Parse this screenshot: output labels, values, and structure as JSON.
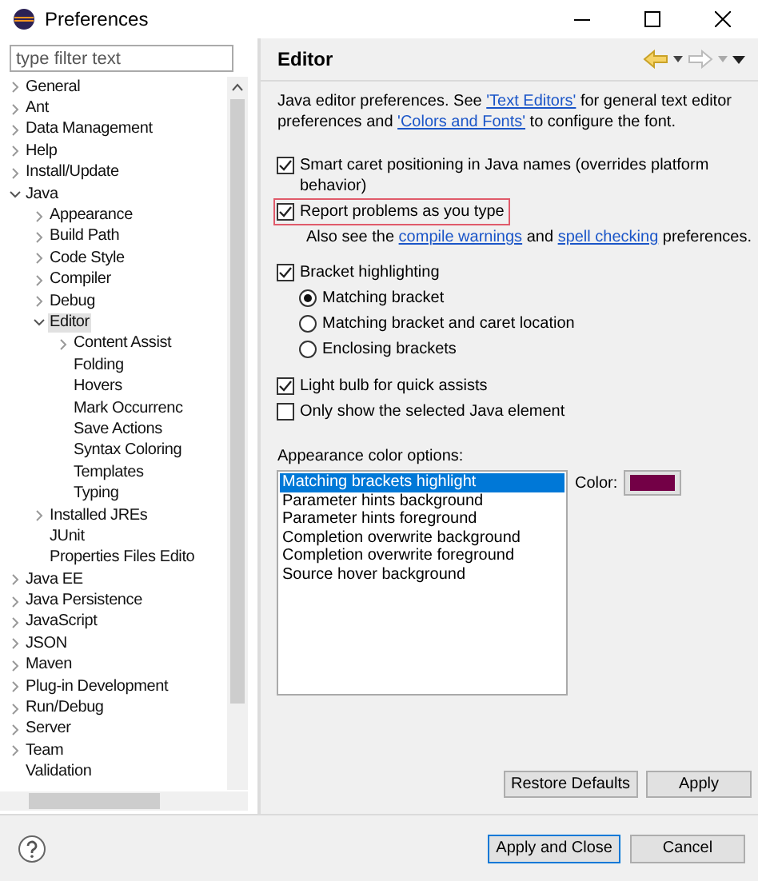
{
  "window": {
    "title": "Preferences"
  },
  "filter": {
    "placeholder": "type filter text"
  },
  "tree": [
    {
      "label": "General",
      "expanded": false,
      "selected": false
    },
    {
      "label": "Ant",
      "expanded": false,
      "selected": false
    },
    {
      "label": "Data Management",
      "expanded": false,
      "selected": false
    },
    {
      "label": "Help",
      "expanded": false,
      "selected": false
    },
    {
      "label": "Install/Update",
      "expanded": false,
      "selected": false
    },
    {
      "label": "Java",
      "expanded": true,
      "selected": false,
      "children": [
        {
          "label": "Appearance",
          "expanded": false,
          "selected": false
        },
        {
          "label": "Build Path",
          "expanded": false,
          "selected": false
        },
        {
          "label": "Code Style",
          "expanded": false,
          "selected": false
        },
        {
          "label": "Compiler",
          "expanded": false,
          "selected": false
        },
        {
          "label": "Debug",
          "expanded": false,
          "selected": false
        },
        {
          "label": "Editor",
          "expanded": true,
          "selected": true,
          "children": [
            {
              "label": "Content Assist",
              "expanded": false,
              "selected": false
            },
            {
              "label": "Folding",
              "selected": false
            },
            {
              "label": "Hovers",
              "selected": false
            },
            {
              "label": "Mark Occurrenc",
              "selected": false
            },
            {
              "label": "Save Actions",
              "selected": false
            },
            {
              "label": "Syntax Coloring",
              "selected": false
            },
            {
              "label": "Templates",
              "selected": false
            },
            {
              "label": "Typing",
              "selected": false
            }
          ]
        },
        {
          "label": "Installed JREs",
          "expanded": false,
          "selected": false
        },
        {
          "label": "JUnit",
          "selected": false
        },
        {
          "label": "Properties Files Edito",
          "selected": false
        }
      ]
    },
    {
      "label": "Java EE",
      "expanded": false,
      "selected": false
    },
    {
      "label": "Java Persistence",
      "expanded": false,
      "selected": false
    },
    {
      "label": "JavaScript",
      "expanded": false,
      "selected": false
    },
    {
      "label": "JSON",
      "expanded": false,
      "selected": false
    },
    {
      "label": "Maven",
      "expanded": false,
      "selected": false
    },
    {
      "label": "Plug-in Development",
      "expanded": false,
      "selected": false
    },
    {
      "label": "Run/Debug",
      "expanded": false,
      "selected": false
    },
    {
      "label": "Server",
      "expanded": false,
      "selected": false
    },
    {
      "label": "Team",
      "expanded": false,
      "selected": false
    },
    {
      "label": "Validation",
      "selected": false
    }
  ],
  "page": {
    "title": "Editor",
    "description": [
      {
        "text": "Java editor preferences. See ",
        "link": false
      },
      {
        "text": "'Text Editors'",
        "link": true
      },
      {
        "text": " for general text editor preferences and ",
        "link": false
      },
      {
        "text": "'Colors and Fonts'",
        "link": true
      },
      {
        "text": " to configure the font.",
        "link": false
      }
    ],
    "option_groups": [
      [
        {
          "kind": "checkbox",
          "label": "Smart caret positioning in Java names (overrides platform behavior)",
          "checked": true,
          "highlighted": false
        },
        {
          "kind": "checkbox",
          "label": "Report problems as you type",
          "checked": true,
          "highlighted": true
        },
        {
          "kind": "note",
          "segments": [
            {
              "text": "Also see the ",
              "link": false
            },
            {
              "text": "compile warnings",
              "link": true
            },
            {
              "text": " and ",
              "link": false
            },
            {
              "text": "spell checking",
              "link": true
            },
            {
              "text": " preferences.",
              "link": false
            }
          ]
        }
      ],
      [
        {
          "kind": "checkbox",
          "label": "Bracket highlighting",
          "checked": true,
          "highlighted": false
        },
        {
          "kind": "radio",
          "label": "Matching bracket",
          "selected": true
        },
        {
          "kind": "radio",
          "label": "Matching bracket and caret location",
          "selected": false
        },
        {
          "kind": "radio",
          "label": "Enclosing brackets",
          "selected": false
        }
      ],
      [
        {
          "kind": "checkbox",
          "label": "Light bulb for quick assists",
          "checked": true,
          "highlighted": false
        },
        {
          "kind": "checkbox",
          "label": "Only show the selected Java element",
          "checked": false,
          "highlighted": false
        }
      ]
    ],
    "color_options": {
      "label": "Appearance color options:",
      "items": [
        {
          "label": "Matching brackets highlight",
          "selected": true
        },
        {
          "label": "Parameter hints background",
          "selected": false
        },
        {
          "label": "Parameter hints foreground",
          "selected": false
        },
        {
          "label": "Completion overwrite background",
          "selected": false
        },
        {
          "label": "Completion overwrite foreground",
          "selected": false
        },
        {
          "label": "Source hover background",
          "selected": false
        }
      ],
      "color_label": "Color:",
      "color": "#730046"
    },
    "buttons": [
      "Restore Defaults",
      "Apply"
    ]
  },
  "footer_buttons": [
    {
      "label": "Apply and Close",
      "default": true
    },
    {
      "label": "Cancel",
      "default": false
    }
  ]
}
